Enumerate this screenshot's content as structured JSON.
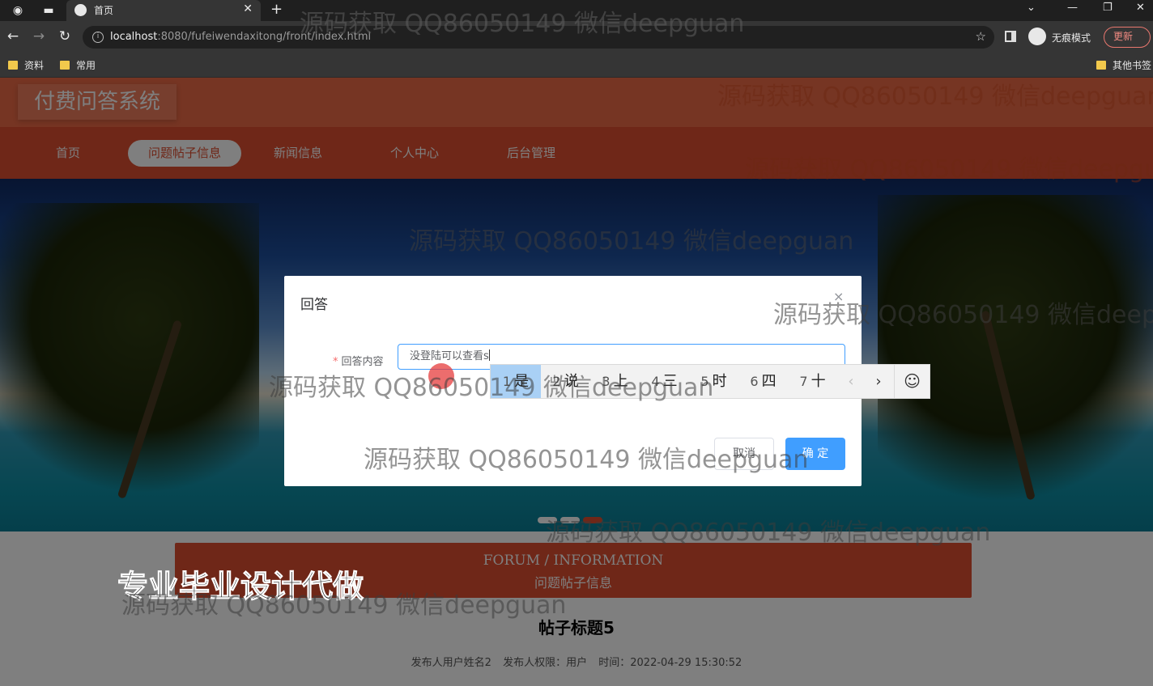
{
  "browser": {
    "tab_title": "首页",
    "url_host": "localhost",
    "url_path": ":8080/fufeiwendaxitong/front/index.html",
    "incognito_label": "无痕模式",
    "update_label": "更新",
    "bookmarks": [
      "资料",
      "常用"
    ],
    "other_bookmarks": "其他书签"
  },
  "site": {
    "logo": "付费问答系统",
    "menu": [
      "首页",
      "问题帖子信息",
      "新闻信息",
      "个人中心",
      "后台管理"
    ],
    "active_menu": "问题帖子信息",
    "section_en": "FORUM / INFORMATION",
    "section_cn": "问题帖子信息",
    "post_title": "帖子标题5",
    "post_meta": {
      "author": "发布人用户姓名2",
      "role": "发布人权限：用户",
      "time": "时间：2022-04-29 15:30:52"
    },
    "promo": "专业毕业设计代做"
  },
  "dialog": {
    "title": "回答",
    "close": "×",
    "field_label": "回答内容",
    "field_value": "没登陆可以查看s",
    "cancel": "取消",
    "confirm": "确 定"
  },
  "ime": {
    "candidates": [
      {
        "n": "1",
        "c": "是"
      },
      {
        "n": "2",
        "c": "说"
      },
      {
        "n": "3",
        "c": "上"
      },
      {
        "n": "4",
        "c": "三"
      },
      {
        "n": "5",
        "c": "时"
      },
      {
        "n": "6",
        "c": "四"
      },
      {
        "n": "7",
        "c": "十"
      }
    ],
    "prev": "‹",
    "next": "›",
    "emoji": "☺"
  },
  "watermark": "源码获取 QQ86050149 微信deepguan",
  "colors": {
    "header": "#ec6a46",
    "menu": "#df4f30",
    "primary": "#409eff"
  }
}
